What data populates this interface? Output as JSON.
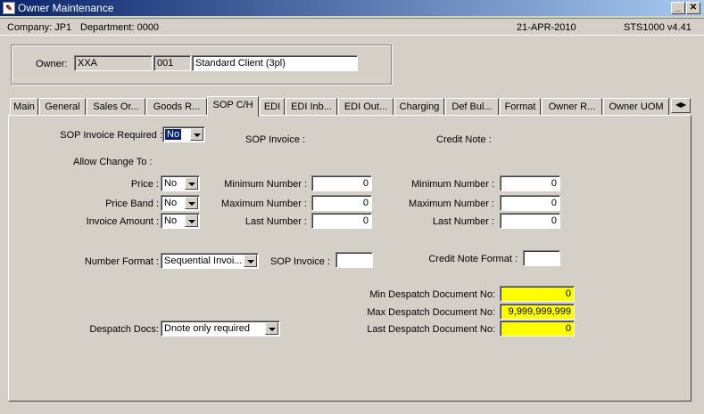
{
  "window": {
    "title": "Owner Maintenance",
    "icon": "app-icon",
    "minimize_label": "_",
    "close_label": "✕"
  },
  "infobar": {
    "company": "Company: JP1",
    "department": "Department: 0000",
    "date": "21-APR-2010",
    "version": "STS1000 v4.41"
  },
  "owner": {
    "label": "Owner:",
    "code": "XXA",
    "number": "001",
    "name": "Standard Client (3pl)"
  },
  "tabs": [
    {
      "label": "Main"
    },
    {
      "label": "General"
    },
    {
      "label": "Sales Or..."
    },
    {
      "label": "Goods R..."
    },
    {
      "label": "SOP C/H"
    },
    {
      "label": "EDI"
    },
    {
      "label": "EDI Inb..."
    },
    {
      "label": "EDI Out..."
    },
    {
      "label": "Charging"
    },
    {
      "label": "Def Bul..."
    },
    {
      "label": "Format"
    },
    {
      "label": "Owner R..."
    },
    {
      "label": "Owner UOM"
    }
  ],
  "tab_scroll_label": "◀▶",
  "sop": {
    "invoice_required_label": "SOP Invoice Required :",
    "invoice_required_value": "No",
    "sop_invoice_heading": "SOP Invoice :",
    "credit_note_heading": "Credit Note :",
    "allow_change_label": "Allow Change To :",
    "price_label": "Price :",
    "price_value": "No",
    "price_band_label": "Price Band :",
    "price_band_value": "No",
    "invoice_amount_label": "Invoice Amount :",
    "invoice_amount_value": "No",
    "inv_min_label": "Minimum Number :",
    "inv_min_value": "0",
    "inv_max_label": "Maximum Number :",
    "inv_max_value": "0",
    "inv_last_label": "Last Number :",
    "inv_last_value": "0",
    "cn_min_label": "Minimum Number :",
    "cn_min_value": "0",
    "cn_max_label": "Maximum Number :",
    "cn_max_value": "0",
    "cn_last_label": "Last Number :",
    "cn_last_value": "0",
    "number_format_label": "Number Format :",
    "number_format_value": "Sequential Invoi...",
    "sop_invoice_format_label": "SOP Invoice :",
    "sop_invoice_format_value": "",
    "credit_note_format_label": "Credit Note Format :",
    "credit_note_format_value": "",
    "despatch_docs_label": "Despatch Docs:",
    "despatch_docs_value": "Dnote only required",
    "min_despatch_label": "Min Despatch Document No:",
    "min_despatch_value": "0",
    "max_despatch_label": "Max Despatch Document No:",
    "max_despatch_value": "9,999,999,999",
    "last_despatch_label": "Last Despatch Document No:",
    "last_despatch_value": "0"
  },
  "colors": {
    "title_bar": "#0a246a",
    "highlight_field": "#ffff00",
    "face": "#d4d0c8"
  }
}
